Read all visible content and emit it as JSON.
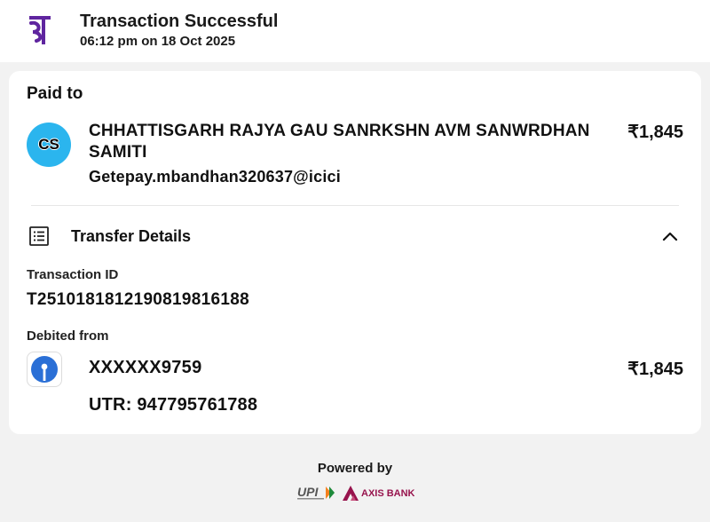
{
  "header": {
    "logo_glyph": "पे",
    "logo_color": "#5f259f",
    "title": "Transaction Successful",
    "datetime": "06:12 pm on 18 Oct 2025"
  },
  "paid_to": {
    "label": "Paid to",
    "avatar_initials": "CS",
    "avatar_color": "#2bb5ee",
    "name": "CHHATTISGARH RAJYA GAU SANRKSHN AVM SANWRDHAN SAMITI",
    "amount": "₹1,845",
    "upi_id": "Getepay.mbandhan320637@icici"
  },
  "transfer_details": {
    "icon": "receipt-list-icon",
    "label": "Transfer Details",
    "toggle_icon": "chevron-up-icon",
    "transaction_id_label": "Transaction ID",
    "transaction_id": "T2510181812190819816188",
    "debited_from_label": "Debited from",
    "bank_icon": "sbi-bank-icon",
    "bank_color": "#2a6fd6",
    "account": "XXXXXX9759",
    "amount": "₹1,845",
    "utr": "UTR: 947795761788"
  },
  "footer": {
    "powered_by": "Powered by",
    "upi_logo": "UPI",
    "bank_logo": "AXIS BANK",
    "bank_logo_color": "#97144d"
  }
}
